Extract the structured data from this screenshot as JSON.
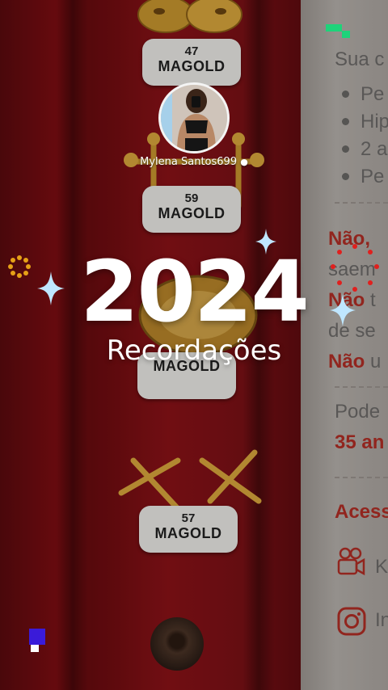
{
  "profile": {
    "username": "Mylena Santos699",
    "verified_icon": "apple-icon"
  },
  "story": {
    "year": "2024",
    "subtitle": "Recordações"
  },
  "tags": [
    {
      "number": "47",
      "brand": "MAGOLD"
    },
    {
      "number": "59",
      "brand": "MAGOLD"
    },
    {
      "number": "",
      "brand": "MAGOLD"
    },
    {
      "number": "57",
      "brand": "MAGOLD"
    }
  ],
  "paper_card": {
    "line_top": "Sua c",
    "bullets": [
      "Pe",
      "Hip",
      "2 a",
      "Pe"
    ],
    "red_1": "Não,",
    "line_2": "saem",
    "red_2": "Não",
    "red_2_rest": "t",
    "line_3": "de se",
    "red_3": "Não",
    "red_3_rest": "u",
    "line_4": "Pode",
    "line_5": "35 an",
    "line_6": "Acess",
    "row_1_text": "K",
    "row_2_text": "In"
  },
  "colors": {
    "accent_red": "#b12e25",
    "sparkle_blue": "#9fd7ff",
    "pixel_green": "#1ed37a",
    "pixel_blue": "#3a1bd9",
    "gold": "#d9a63c"
  }
}
